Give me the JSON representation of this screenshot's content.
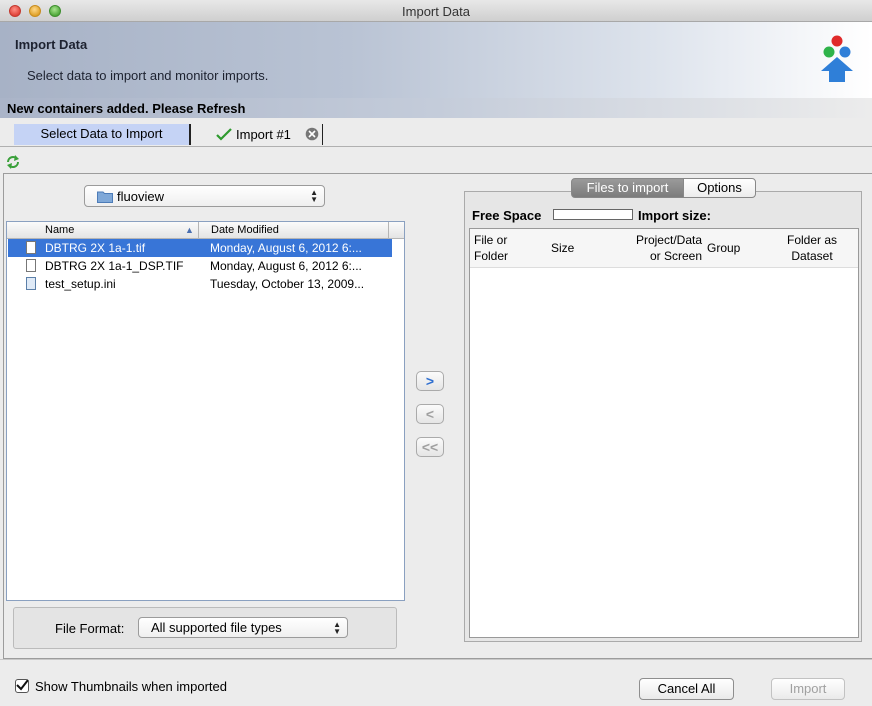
{
  "window": {
    "title": "Import Data"
  },
  "banner": {
    "heading": "Import Data",
    "subtitle": "Select data to import and monitor imports.",
    "notice": "New containers added. Please Refresh"
  },
  "tabs": [
    {
      "label": "Select Data to Import"
    },
    {
      "label": "Import #1"
    }
  ],
  "folder": {
    "selected": "fluoview"
  },
  "filelist": {
    "columns": [
      "Name",
      "Date Modified"
    ],
    "rows": [
      {
        "name": "DBTRG 2X 1a-1.tif",
        "date": "Monday, August 6, 2012 6:...",
        "selected": true
      },
      {
        "name": "DBTRG 2X 1a-1_DSP.TIF",
        "date": "Monday, August 6, 2012 6:...",
        "selected": false
      },
      {
        "name": "test_setup.ini",
        "date": "Tuesday, October 13, 2009...",
        "selected": false
      }
    ]
  },
  "format": {
    "label": "File Format:",
    "selected": "All supported file types"
  },
  "right": {
    "tabs": [
      "Files to import",
      "Options"
    ],
    "free_space_label": "Free Space",
    "import_size_label": "Import size:",
    "columns": [
      {
        "line1": "File or",
        "line2": "Folder"
      },
      {
        "line1": "Size",
        "line2": ""
      },
      {
        "line1": "Project/Data",
        "line2": "or Screen"
      },
      {
        "line1": "Group",
        "line2": ""
      },
      {
        "line1": "Folder as",
        "line2": "Dataset"
      }
    ]
  },
  "bottom": {
    "thumbnail_label": "Show Thumbnails when imported",
    "thumbnail_checked": true,
    "cancel_label": "Cancel All",
    "import_label": "Import"
  },
  "colors": {
    "selection": "#3875d7",
    "tab_active": "#c5d3f5",
    "logo_red": "#e02a2a",
    "logo_green": "#2fb34a",
    "logo_blue": "#2f7fd8"
  }
}
